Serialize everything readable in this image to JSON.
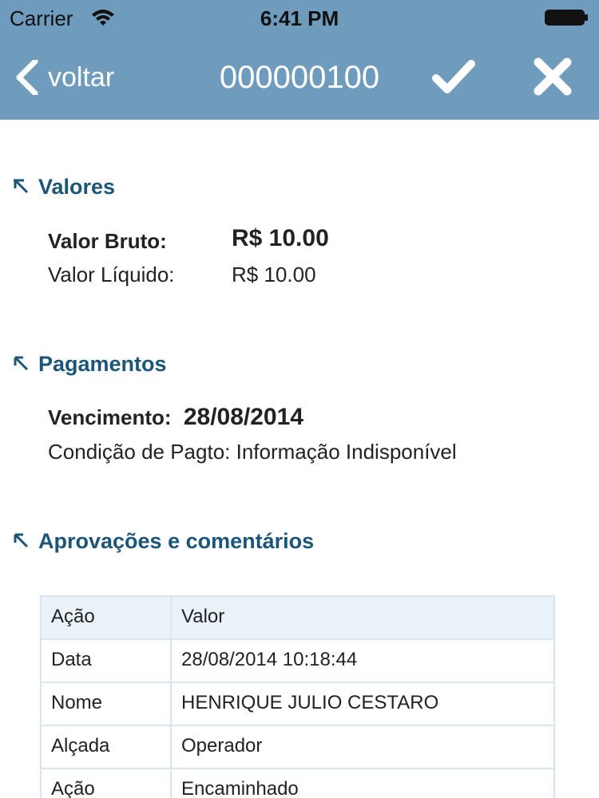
{
  "status": {
    "carrier": "Carrier",
    "time": "6:41 PM"
  },
  "nav": {
    "back_label": "voltar",
    "title": "000000100"
  },
  "sections": {
    "valores": {
      "title": "Valores"
    },
    "pagamentos": {
      "title": "Pagamentos"
    },
    "aprovacoes": {
      "title": "Aprovações e comentários"
    }
  },
  "valores": {
    "bruto_label": "Valor Bruto:",
    "bruto_value": "R$ 10.00",
    "liquido_label": "Valor Líquido:",
    "liquido_value": "R$ 10.00"
  },
  "pagamentos": {
    "vencimento_label": "Vencimento:",
    "vencimento_value": "28/08/2014",
    "condicao_text": "Condição de Pagto: Informação Indisponível"
  },
  "table": {
    "headers": [
      "Ação",
      "Valor"
    ],
    "rows": [
      [
        "Data",
        "28/08/2014 10:18:44"
      ],
      [
        "Nome",
        "HENRIQUE JULIO CESTARO"
      ],
      [
        "Alçada",
        "Operador"
      ],
      [
        "Ação",
        "Encaminhado"
      ]
    ]
  },
  "colors": {
    "nav_bg": "#6f9bbd",
    "section_title": "#1b5679",
    "table_border": "#d9e6ef",
    "table_header_bg": "#e9f2f9"
  },
  "icons": {
    "back": "chevron-left-icon",
    "confirm": "check-icon",
    "cancel": "close-icon",
    "section": "arrow-up-left-icon"
  }
}
